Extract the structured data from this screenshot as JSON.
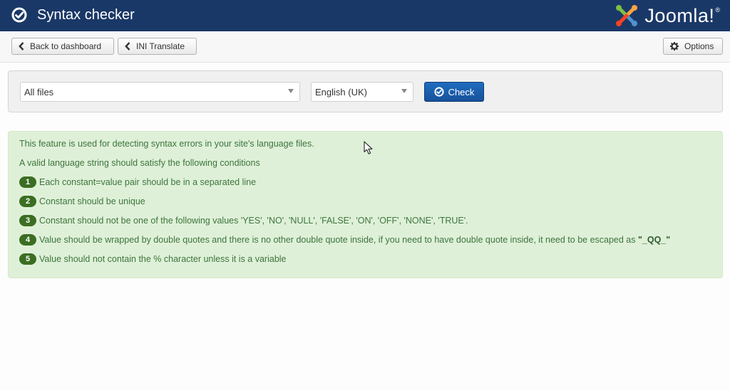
{
  "header": {
    "title": "Syntax checker",
    "logo_text": "Joomla!",
    "logo_reg": "®"
  },
  "toolbar": {
    "back_label": "Back to dashboard",
    "ini_label": "INI Translate",
    "options_label": "Options"
  },
  "filters": {
    "files_selected": "All files",
    "language_selected": "English (UK)",
    "check_label": "Check"
  },
  "info": {
    "intro": "This feature is used for detecting syntax errors in your site's language files.",
    "subtitle": "A valid language string should satisfy the following conditions",
    "conditions": [
      {
        "num": "1",
        "text": "Each constant=value pair should be in a separated line"
      },
      {
        "num": "2",
        "text": "Constant should be unique"
      },
      {
        "num": "3",
        "text": "Constant should not be one of the following values 'YES', 'NO', 'NULL', 'FALSE', 'ON', 'OFF', 'NONE', 'TRUE'."
      },
      {
        "num": "4",
        "text": "Value should be wrapped by double quotes and there is no other double quote inside, if you need to have double quote inside, it need to be escaped as ",
        "code": "\"_QQ_\""
      },
      {
        "num": "5",
        "text": "Value should not contain the % character unless it is a variable"
      }
    ]
  },
  "colors": {
    "header_bg": "#1a3867",
    "alert_bg": "#dff0d8",
    "alert_text": "#3c763d",
    "badge_bg": "#3b6e22",
    "primary_btn": "#17519a"
  }
}
